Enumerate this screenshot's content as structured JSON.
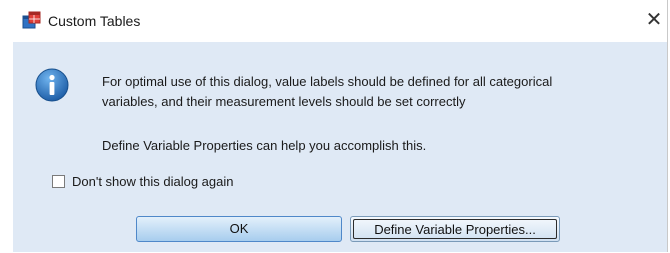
{
  "window": {
    "title": "Custom Tables",
    "close_glyph": "✕",
    "app_icon": "custom-tables-app-icon"
  },
  "message": {
    "icon": "info-icon",
    "line1": "For optimal use of this dialog, value labels should be defined for all categorical",
    "line2": "variables, and their measurement levels should be set correctly",
    "line3": "Define Variable Properties can help you accomplish this."
  },
  "checkbox": {
    "label": "Don't show this dialog again",
    "checked": false
  },
  "buttons": {
    "ok": "OK",
    "define": "Define Variable Properties..."
  },
  "colors": {
    "client_bg": "#dfe9f5",
    "ok_button_bg": "#a7cdee",
    "info_icon": "#1f6fb8"
  }
}
